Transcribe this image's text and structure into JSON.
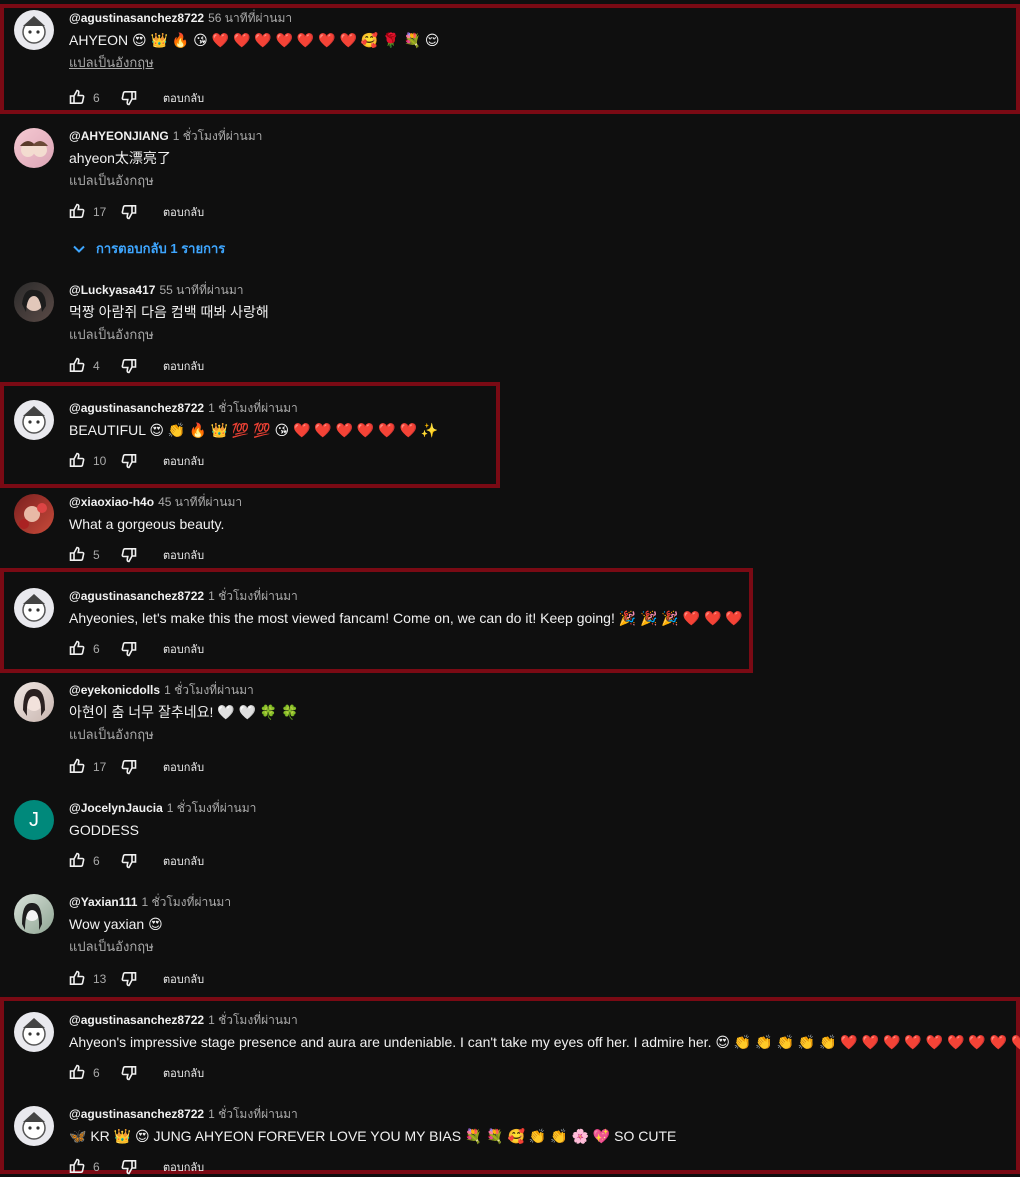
{
  "reply_label": "ตอบกลับ",
  "translate_label": "แปลเป็นอังกฤษ",
  "replies_toggle_label": "การตอบกลับ 1 รายการ",
  "highlight_color": "#7a0a14",
  "comments": [
    {
      "author": "@agustinasanchez8722",
      "time": "56 นาทีที่ผ่านมา",
      "text": "AHYEON 😍 👑 🔥 😘 ❤️ ❤️ ❤️ ❤️ ❤️ ❤️ ❤️ 🥰 🌹 💐 😌",
      "likes": "6",
      "avatar_icon": "anime-avatar"
    },
    {
      "author": "@AHYEONJIANG",
      "time": "1 ชั่วโมงที่ผ่านมา",
      "text": "ahyeon太漂亮了",
      "likes": "17",
      "avatar_icon": "photo-avatar"
    },
    {
      "author": "@Luckyasa417",
      "time": "55 นาทีที่ผ่านมา",
      "text": "먹짱 아람쥐 다음 컴백 때봐 사랑해",
      "likes": "4",
      "avatar_icon": "photo-avatar"
    },
    {
      "author": "@agustinasanchez8722",
      "time": "1 ชั่วโมงที่ผ่านมา",
      "text": "BEAUTIFUL 😍 👏 🔥 👑 💯 💯 😘 ❤️ ❤️ ❤️ ❤️ ❤️ ❤️ ✨",
      "likes": "10",
      "avatar_icon": "anime-avatar"
    },
    {
      "author": "@xiaoxiao-h4o",
      "time": "45 นาทีที่ผ่านมา",
      "text": "What a gorgeous beauty.",
      "likes": "5",
      "avatar_icon": "photo-avatar"
    },
    {
      "author": "@agustinasanchez8722",
      "time": "1 ชั่วโมงที่ผ่านมา",
      "text": "Ahyeonies, let's make this the most viewed fancam! Come on, we can do it! Keep going! 🎉 🎉 🎉 ❤️ ❤️ ❤️",
      "likes": "6",
      "avatar_icon": "anime-avatar"
    },
    {
      "author": "@eyekonicdolls",
      "time": "1 ชั่วโมงที่ผ่านมา",
      "text": "아현이 춤 너무 잘추네요! 🤍 🤍 🍀 🍀",
      "likes": "17",
      "avatar_icon": "photo-avatar"
    },
    {
      "author": "@JocelynJaucia",
      "time": "1 ชั่วโมงที่ผ่านมา",
      "text": "GODDESS",
      "likes": "6",
      "avatar_letter": "J"
    },
    {
      "author": "@Yaxian111",
      "time": "1 ชั่วโมงที่ผ่านมา",
      "text": "Wow yaxian  😍",
      "likes": "13",
      "avatar_icon": "photo-avatar"
    },
    {
      "author": "@agustinasanchez8722",
      "time": "1 ชั่วโมงที่ผ่านมา",
      "text": "Ahyeon's impressive stage presence and aura are undeniable. I can't take my eyes off her. I admire her. 😍 👏 👏 👏 👏 👏 ❤️ ❤️ ❤️ ❤️ ❤️ ❤️ ❤️ ❤️ ❤️",
      "likes": "6",
      "avatar_icon": "anime-avatar"
    },
    {
      "author": "@agustinasanchez8722",
      "time": "1 ชั่วโมงที่ผ่านมา",
      "text": "🦋 KR 👑 😍 JUNG AHYEON FOREVER LOVE YOU MY BIAS 💐 💐 🥰 👏 👏 🌸 💖  SO CUTE",
      "likes": "6",
      "avatar_icon": "anime-avatar"
    }
  ]
}
